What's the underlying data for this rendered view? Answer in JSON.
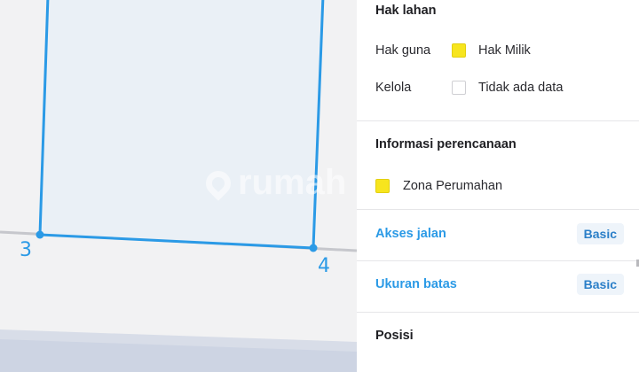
{
  "map": {
    "vertices": [
      "3",
      "4"
    ],
    "watermark": "rumah"
  },
  "panel": {
    "land_rights": {
      "title": "Hak lahan",
      "rows": [
        {
          "label": "Hak guna",
          "value": "Hak Milik",
          "swatch": "yellow"
        },
        {
          "label": "Kelola",
          "value": "Tidak ada data",
          "swatch": "empty"
        }
      ]
    },
    "planning": {
      "title": "Informasi perencanaan",
      "zone": "Zona Perumahan"
    },
    "road_access": {
      "title": "Akses jalan",
      "badge": "Basic"
    },
    "boundary_size": {
      "title": "Ukuran batas",
      "badge": "Basic"
    },
    "position": {
      "title": "Posisi"
    }
  },
  "colors": {
    "accent": "#2b9ae6",
    "parcel_fill": "#eaf0f6",
    "zone_yellow": "#f7e51e",
    "road": "#c6c7cc"
  }
}
